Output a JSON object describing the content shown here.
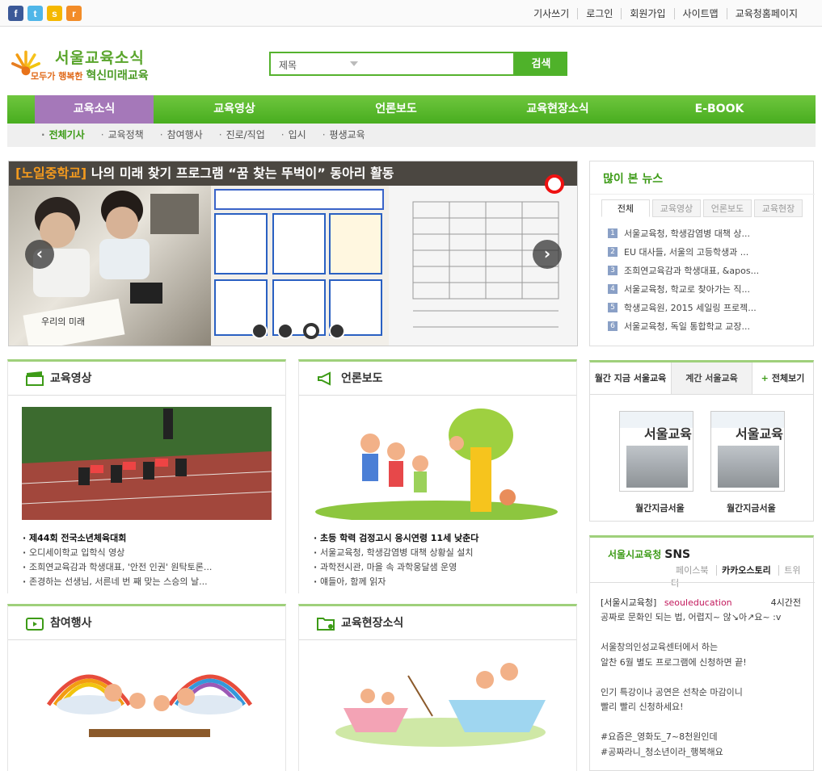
{
  "topbar": {
    "social": [
      {
        "icon": "facebook-icon",
        "glyph": "f",
        "color": "#3b5998"
      },
      {
        "icon": "twitter-icon",
        "glyph": "t",
        "color": "#4fb6e8"
      },
      {
        "icon": "kakaostory-icon",
        "glyph": "s",
        "color": "#f5b800"
      },
      {
        "icon": "rss-icon",
        "glyph": "r",
        "color": "#f28c28"
      }
    ],
    "links": [
      "기사쓰기",
      "로그인",
      "회원가입",
      "사이트맵",
      "교육청홈페이지"
    ]
  },
  "logo": {
    "title": "서울교육소식",
    "tagline_pre": "모두가 행복한",
    "tagline_main": "혁신미래교육"
  },
  "search": {
    "select_value": "제목",
    "button": "검색"
  },
  "gnb": [
    "교육소식",
    "교육영상",
    "언론보도",
    "교육현장소식",
    "E-BOOK"
  ],
  "subnav": [
    "전체기사",
    "교육정책",
    "참여행사",
    "진로/직업",
    "입시",
    "평생교육"
  ],
  "slider": {
    "caption_tag": "[노일중학교]",
    "caption": "나의 미래 찾기 프로그램 “꿈 찾는 뚜벅이” 동아리 활동",
    "prev": "‹",
    "next": "›",
    "dots": 4,
    "active_dot": 2
  },
  "popular": {
    "title": "많이 본 뉴스",
    "tabs": [
      "전체",
      "교육영상",
      "언론보도",
      "교육현장"
    ],
    "items": [
      "서울교육청, 학생감염병 대책 상...",
      "EU 대사들, 서울의 고등학생과 ...",
      "조희연교육감과 학생대표, &apos...",
      "서울교육청, 학교로 찾아가는 직...",
      "학생교육원, 2015 세일링 프로젝...",
      "서울교육청, 독일 통합학교 교장..."
    ]
  },
  "video": {
    "title": "교육영상",
    "items": [
      "제44회 전국소년체육대회",
      "오디세이학교 입학식 영상",
      "조희연교육감과 학생대표, '안전 인권' 원탁토론...",
      "존경하는 선생님, 서른네 번 째 맞는 스승의 날..."
    ]
  },
  "press": {
    "title": "언론보도",
    "items": [
      "초등 학력 검정고시 응시연령 11세 낮춘다",
      "서울교육청, 학생감염병 대책 상황실 설치",
      "과학전시관, 마을 속 과학웅달샘 운영",
      "얘들아, 함께 읽자"
    ]
  },
  "events": {
    "title": "참여행사"
  },
  "field": {
    "title": "교육현장소식"
  },
  "magazine": {
    "tabs": [
      "월간 지금 서울교육",
      "계간 서울교육",
      "전체보기"
    ],
    "plus": "+",
    "covers": [
      {
        "title": "서울교육",
        "label": "월간지금서울"
      },
      {
        "title": "서울교육",
        "label": "월간지금서울"
      }
    ]
  },
  "sns": {
    "org": "서울시교육청",
    "title": "SNS",
    "tabs": [
      "페이스북",
      "카카오스토리",
      "트위터"
    ],
    "active_tab": 1,
    "author": "[서울시교육청]",
    "handle": "seouleducation",
    "time": "4시간전",
    "body": "공짜로 문화인 되는 법, 어렵지~ 않↘아↗요~ :v\n\n서울창의인성교육센터에서 하는\n알찬 6월 별도 프로그램에 신청하면 끝!\n\n인기 특강이나 공연은 선착순 마감이니\n빨리 빨리 신청하세요!\n\n#요즘은_영화도_7~8천원인데\n#공짜라니_청소년이라_행복해요"
  }
}
